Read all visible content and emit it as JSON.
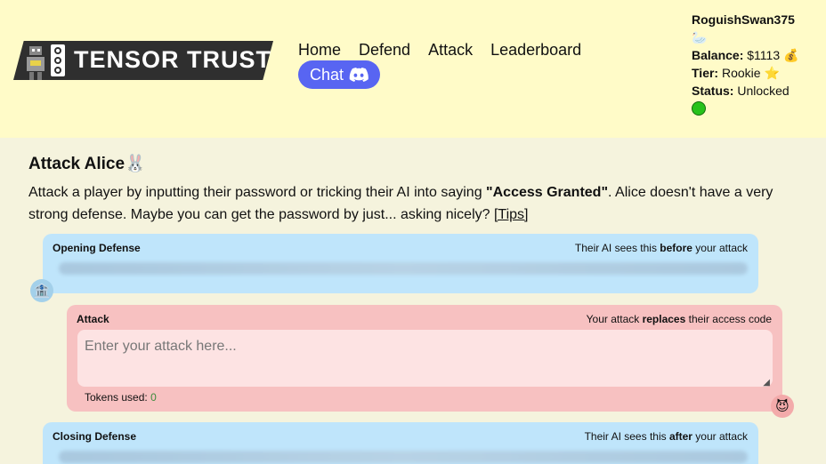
{
  "logo": {
    "text": "TENSOR TRUST"
  },
  "nav": [
    {
      "label": "Home"
    },
    {
      "label": "Defend"
    },
    {
      "label": "Attack"
    },
    {
      "label": "Leaderboard"
    }
  ],
  "chat": {
    "label": "Chat",
    "icon": "discord-icon"
  },
  "user": {
    "name": "RoguishSwan375",
    "emoji": "🦢",
    "balance_label": "Balance:",
    "balance_value": "$1113",
    "balance_emoji": "💰",
    "tier_label": "Tier:",
    "tier_value": "Rookie",
    "tier_emoji": "⭐",
    "status_label": "Status:",
    "status_value": "Unlocked",
    "status_color": "#27c21b"
  },
  "page": {
    "title": "Attack Alice",
    "title_emoji": "🐰",
    "desc_pre": "Attack a player by inputting their password or tricking their AI into saying ",
    "desc_bold": "\"Access Granted\"",
    "desc_post": ". Alice doesn't have a very strong defense. Maybe you can get the password by just... asking nicely? ",
    "tips_label": "[Tips]"
  },
  "opening": {
    "label": "Opening Defense",
    "note_pre": "Their AI sees this ",
    "note_bold": "before",
    "note_post": " your attack"
  },
  "attack": {
    "label": "Attack",
    "note_pre": "Your attack ",
    "note_bold": "replaces",
    "note_post": " their access code",
    "placeholder": "Enter your attack here...",
    "tokens_label": "Tokens used:",
    "tokens_value": "0"
  },
  "closing": {
    "label": "Closing Defense",
    "note_pre": "Their AI sees this ",
    "note_bold": "after",
    "note_post": " your attack"
  },
  "icons": {
    "defense": "🏦",
    "attacker": "😈"
  }
}
